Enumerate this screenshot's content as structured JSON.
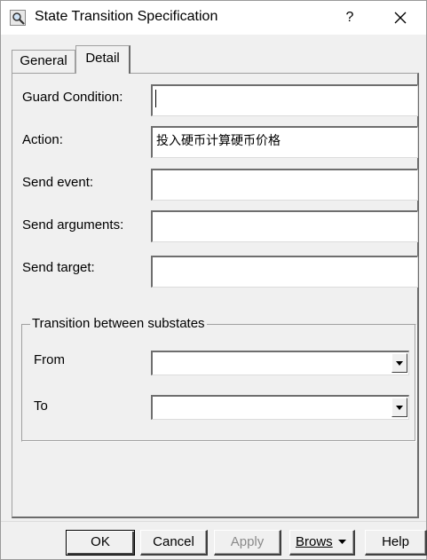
{
  "window": {
    "title": "State Transition Specification",
    "help_glyph": "?"
  },
  "tabs": [
    {
      "label": "General",
      "active": false
    },
    {
      "label": "Detail",
      "active": true
    }
  ],
  "fields": {
    "guard_condition": {
      "label": "Guard Condition:",
      "value": ""
    },
    "action": {
      "label": "Action:",
      "value": "投入硬币计算硬币价格"
    },
    "send_event": {
      "label": "Send event:",
      "value": ""
    },
    "send_arguments": {
      "label": "Send arguments:",
      "value": ""
    },
    "send_target": {
      "label": "Send target:",
      "value": ""
    }
  },
  "substates": {
    "group_label": "Transition between substates",
    "from_label": "From",
    "from_value": "",
    "to_label": "To",
    "to_value": ""
  },
  "buttons": {
    "ok": "OK",
    "cancel": "Cancel",
    "apply": "Apply",
    "browse": "Brows",
    "help": "Help"
  },
  "icons": {
    "title": "magnifier-icon",
    "close": "close-icon",
    "dropdown": "dropdown-arrow-icon"
  }
}
